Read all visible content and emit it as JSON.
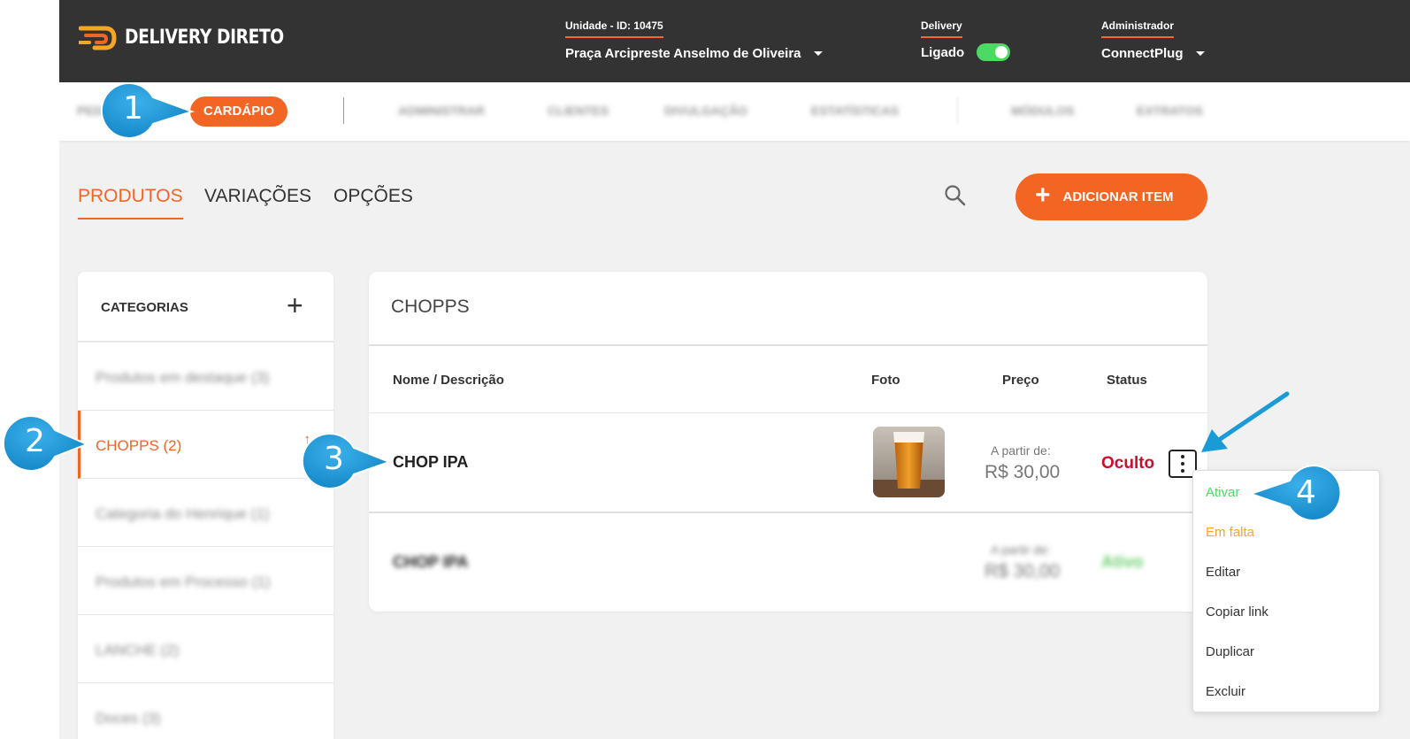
{
  "brand": {
    "name": "DELIVERY DIRETO",
    "colors": {
      "accent": "#f26522",
      "header": "#333333",
      "toggle_on": "#4cd964",
      "status_hidden": "#c8102e",
      "status_active": "#6fcf6f"
    }
  },
  "header": {
    "unit": {
      "label": "Unidade - ID: 10475",
      "value": "Praça Arcipreste Anselmo de Oliveira"
    },
    "delivery": {
      "label": "Delivery",
      "value": "Ligado",
      "enabled": true
    },
    "admin": {
      "label": "Administrador",
      "value": "ConnectPlug"
    }
  },
  "nav": {
    "active": "CARDÁPIO",
    "blurred_items": [
      "PEDIDOS",
      "ADMINISTRAR",
      "CLIENTES",
      "DIVULGAÇÃO",
      "ESTATÍSTICAS",
      "MÓDULOS",
      "EXTRATOS"
    ]
  },
  "subtabs": [
    {
      "label": "PRODUTOS",
      "active": true
    },
    {
      "label": "VARIAÇÕES",
      "active": false
    },
    {
      "label": "OPÇÕES",
      "active": false
    }
  ],
  "search_icon": "search-icon",
  "add_button": {
    "label": "ADICIONAR ITEM",
    "icon": "plus-icon"
  },
  "categories": {
    "title": "CATEGORIAS",
    "add_icon": "plus-icon",
    "items": [
      {
        "label": "Produtos em destaque (3)",
        "blurred": true
      },
      {
        "label": "CHOPPS (2)",
        "active": true,
        "blurred": false
      },
      {
        "label": "Categoria do Henrique (1)",
        "blurred": true
      },
      {
        "label": "Produtos em Processo (1)",
        "blurred": true
      },
      {
        "label": "LANCHE (2)",
        "blurred": true
      },
      {
        "label": "Doces (3)",
        "blurred": true
      }
    ]
  },
  "products": {
    "category_title": "CHOPPS",
    "columns": {
      "name": "Nome / Descrição",
      "photo": "Foto",
      "price": "Preço",
      "status": "Status"
    },
    "rows": [
      {
        "name": "CHOP IPA",
        "price_prefix": "A partir de:",
        "price": "R$ 30,00",
        "status": "Oculto",
        "has_photo": true,
        "blurred": false
      },
      {
        "name": "CHOP IPA",
        "price_prefix": "A partir de:",
        "price": "R$ 30,00",
        "status": "Ativo",
        "has_photo": false,
        "blurred": true
      }
    ]
  },
  "context_menu": {
    "items": [
      {
        "label": "Ativar",
        "color": "#4cd964"
      },
      {
        "label": "Em falta",
        "color": "#f5a623"
      },
      {
        "label": "Editar",
        "color": "#333333"
      },
      {
        "label": "Copiar link",
        "color": "#333333"
      },
      {
        "label": "Duplicar",
        "color": "#333333"
      },
      {
        "label": "Excluir",
        "color": "#333333"
      }
    ]
  },
  "callouts": [
    "1",
    "2",
    "3",
    "4"
  ]
}
